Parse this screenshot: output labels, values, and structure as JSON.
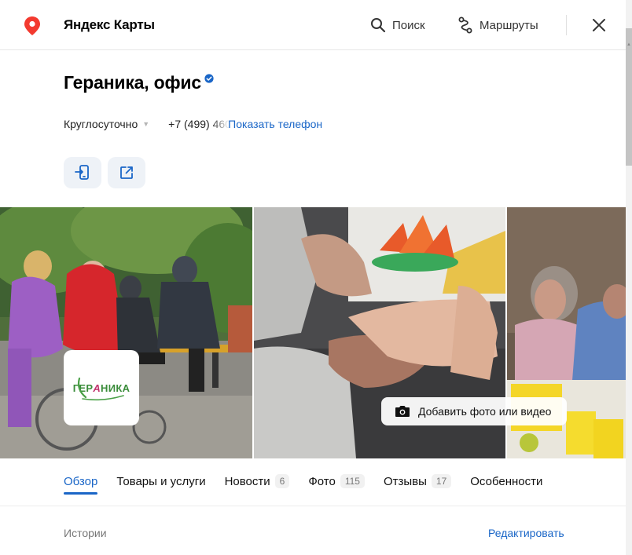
{
  "header": {
    "app_title": "Яндекс Карты",
    "search_label": "Поиск",
    "routes_label": "Маршруты",
    "brand_color": "#f33a2f"
  },
  "org": {
    "title": "Гераника, офис",
    "verified": true,
    "hours": "Круглосуточно",
    "phone_partial": "+7 (499) 460",
    "show_phone": "Показать телефон"
  },
  "actions": [
    {
      "icon": "phone-transfer-icon"
    },
    {
      "icon": "external-link-icon"
    }
  ],
  "gallery": {
    "logo_text_left": "ГЕР",
    "logo_text_accent": "А",
    "logo_text_right": "НИКА",
    "add_photo_label": "Добавить фото или видео"
  },
  "tabs": [
    {
      "label": "Обзор",
      "count": null,
      "active": true
    },
    {
      "label": "Товары и услуги",
      "count": null,
      "active": false
    },
    {
      "label": "Новости",
      "count": "6",
      "active": false
    },
    {
      "label": "Фото",
      "count": "115",
      "active": false
    },
    {
      "label": "Отзывы",
      "count": "17",
      "active": false
    },
    {
      "label": "Особенности",
      "count": null,
      "active": false
    }
  ],
  "stories": {
    "label": "Истории",
    "edit_label": "Редактировать"
  },
  "colors": {
    "accent": "#1a66c7",
    "action_bg": "#eef2f7"
  }
}
